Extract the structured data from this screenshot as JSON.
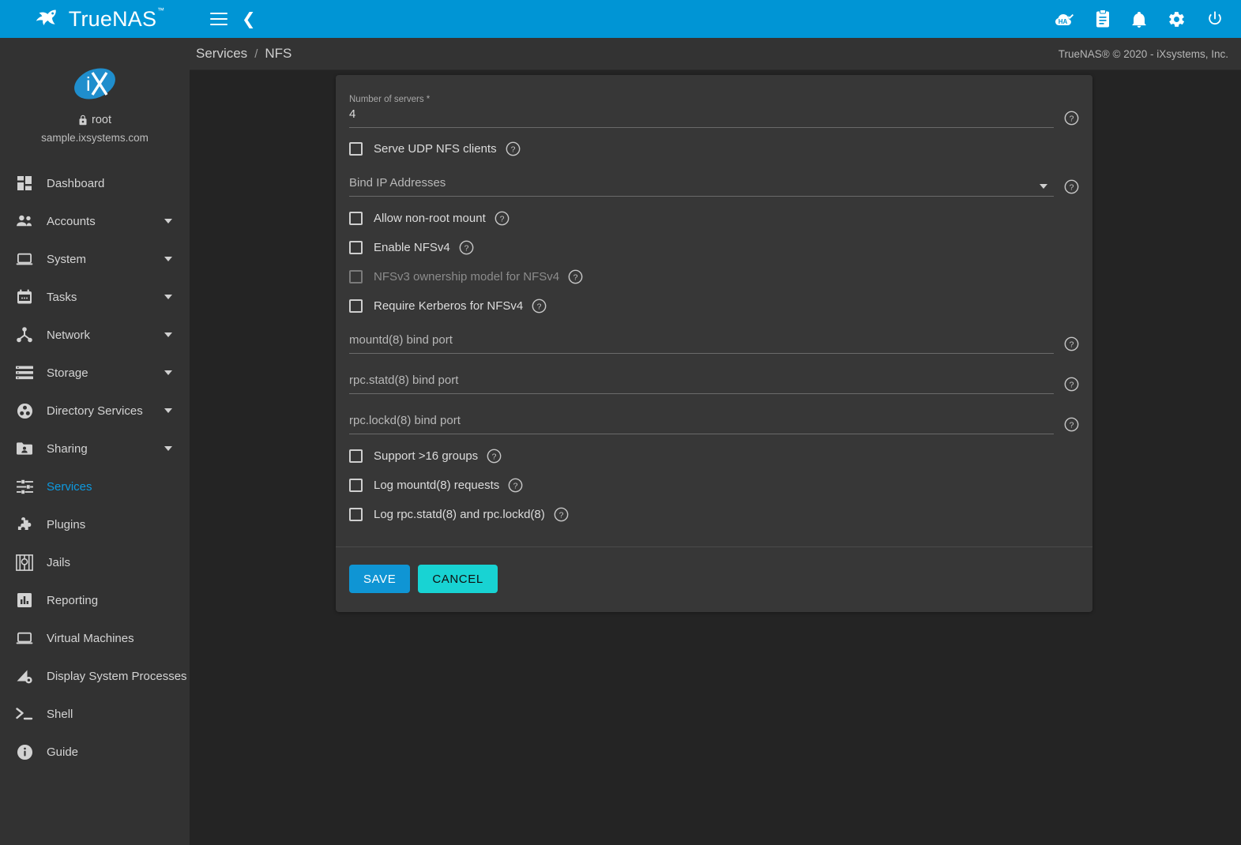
{
  "topbar": {
    "brand_name": "TrueNAS",
    "brand_tm": "™",
    "icons": [
      {
        "name": "ha-status-icon",
        "label": "HA"
      },
      {
        "name": "clipboard-tasks-icon",
        "label": "Tasks"
      },
      {
        "name": "bell-notifications-icon",
        "label": "Notifications"
      },
      {
        "name": "gear-settings-icon",
        "label": "Settings"
      },
      {
        "name": "power-icon",
        "label": "Power"
      }
    ],
    "menu_toggle": "hamburger-menu-icon",
    "collapse_toggle": "chevron-left-icon"
  },
  "sidebar": {
    "username": "root",
    "hostname": "sample.ixsystems.com",
    "logo_text": "iX",
    "items": [
      {
        "label": "Dashboard",
        "icon": "dashboard-icon",
        "expandable": false,
        "active": false
      },
      {
        "label": "Accounts",
        "icon": "accounts-people-icon",
        "expandable": true,
        "active": false
      },
      {
        "label": "System",
        "icon": "system-laptop-icon",
        "expandable": true,
        "active": false
      },
      {
        "label": "Tasks",
        "icon": "tasks-calendar-icon",
        "expandable": true,
        "active": false
      },
      {
        "label": "Network",
        "icon": "network-share-icon",
        "expandable": true,
        "active": false
      },
      {
        "label": "Storage",
        "icon": "storage-list-icon",
        "expandable": true,
        "active": false
      },
      {
        "label": "Directory Services",
        "icon": "directory-services-icon",
        "expandable": true,
        "active": false
      },
      {
        "label": "Sharing",
        "icon": "sharing-folder-icon",
        "expandable": true,
        "active": false
      },
      {
        "label": "Services",
        "icon": "services-tune-icon",
        "expandable": false,
        "active": true
      },
      {
        "label": "Plugins",
        "icon": "plugins-puzzle-icon",
        "expandable": false,
        "active": false
      },
      {
        "label": "Jails",
        "icon": "jails-icon",
        "expandable": false,
        "active": false
      },
      {
        "label": "Reporting",
        "icon": "reporting-chart-icon",
        "expandable": false,
        "active": false
      },
      {
        "label": "Virtual Machines",
        "icon": "virtual-machines-icon",
        "expandable": false,
        "active": false
      },
      {
        "label": "Display System Processes",
        "icon": "system-processes-icon",
        "expandable": false,
        "active": false
      },
      {
        "label": "Shell",
        "icon": "shell-terminal-icon",
        "expandable": false,
        "active": false
      },
      {
        "label": "Guide",
        "icon": "guide-info-icon",
        "expandable": false,
        "active": false
      }
    ]
  },
  "breadcrumb": {
    "items": [
      "Services",
      "NFS"
    ],
    "separator": "/"
  },
  "copyright": "TrueNAS® © 2020 - iXsystems, Inc.",
  "form": {
    "fields": [
      {
        "kind": "text",
        "name": "number-of-servers",
        "label": "Number of servers *",
        "value": "4",
        "help": "?"
      },
      {
        "kind": "checkbox",
        "name": "serve-udp-nfs-clients",
        "label": "Serve UDP NFS clients",
        "checked": false,
        "disabled": false,
        "help": "?"
      },
      {
        "kind": "select",
        "name": "bind-ip-addresses",
        "label": "Bind IP Addresses",
        "value": "",
        "help": "?"
      },
      {
        "kind": "checkbox",
        "name": "allow-non-root-mount",
        "label": "Allow non-root mount",
        "checked": false,
        "disabled": false,
        "help": "?"
      },
      {
        "kind": "checkbox",
        "name": "enable-nfsv4",
        "label": "Enable NFSv4",
        "checked": false,
        "disabled": false,
        "help": "?"
      },
      {
        "kind": "checkbox",
        "name": "nfsv3-ownership-model",
        "label": "NFSv3 ownership model for NFSv4",
        "checked": false,
        "disabled": true,
        "help": "?"
      },
      {
        "kind": "checkbox",
        "name": "require-kerberos-nfsv4",
        "label": "Require Kerberos for NFSv4",
        "checked": false,
        "disabled": false,
        "help": "?"
      },
      {
        "kind": "text",
        "name": "mountd-bind-port",
        "label": "mountd(8) bind port",
        "value": "",
        "help": "?"
      },
      {
        "kind": "text",
        "name": "rpc-statd-bind-port",
        "label": "rpc.statd(8) bind port",
        "value": "",
        "help": "?"
      },
      {
        "kind": "text",
        "name": "rpc-lockd-bind-port",
        "label": "rpc.lockd(8) bind port",
        "value": "",
        "help": "?"
      },
      {
        "kind": "checkbox",
        "name": "support-16-groups",
        "label": "Support >16 groups",
        "checked": false,
        "disabled": false,
        "help": "?"
      },
      {
        "kind": "checkbox",
        "name": "log-mountd-requests",
        "label": "Log mountd(8) requests",
        "checked": false,
        "disabled": false,
        "help": "?"
      },
      {
        "kind": "checkbox",
        "name": "log-rpc-statd-lockd",
        "label": "Log rpc.statd(8) and rpc.lockd(8)",
        "checked": false,
        "disabled": false,
        "help": "?"
      }
    ],
    "save_label": "SAVE",
    "cancel_label": "CANCEL"
  },
  "colors": {
    "brand_blue": "#0095d5",
    "accent_blue": "#0f95d4",
    "accent_cyan": "#18d3d3",
    "active_link": "#0d9ae0",
    "sidebar_bg": "#323232",
    "content_bg": "#242424",
    "card_bg": "#373737"
  }
}
